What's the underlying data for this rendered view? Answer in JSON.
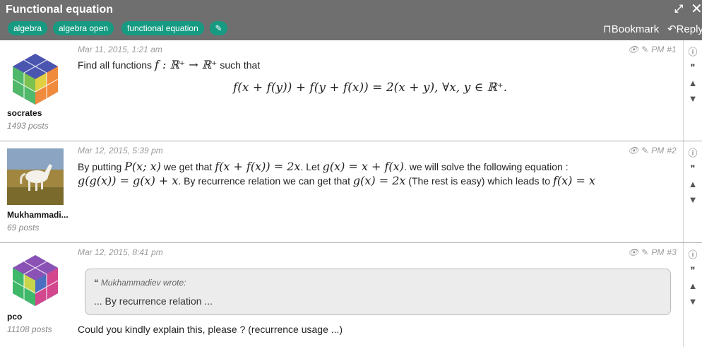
{
  "header": {
    "title": "Functional equation",
    "tags": [
      "algebra",
      "algebra open",
      "functional equation"
    ],
    "bookmark_label": "Bookmark",
    "reply_label": "Reply"
  },
  "posts": [
    {
      "date": "Mar 11, 2015, 1:21 am",
      "pm": "PM",
      "number": "#1",
      "user": "socrates",
      "post_count": "1493 posts",
      "text_a": "Find all functions",
      "math_a": "f : ℝ⁺ → ℝ⁺",
      "text_b": "such that",
      "display": "f(x + f(y)) + f(y + f(x)) = 2(x + y),    ∀x, y ∈ ℝ⁺."
    },
    {
      "date": "Mar 12, 2015, 5:39 pm",
      "pm": "PM",
      "number": "#2",
      "user": "Mukhammadi...",
      "post_count": "69 posts",
      "t1": "By putting",
      "m1": "P(x; x)",
      "t2": "we get that",
      "m2": "f(x + f(x)) = 2x",
      "t3": ". Let",
      "m3": "g(x) = x + f(x)",
      "t4": ". we will solve the following equation :",
      "m4": "g(g(x)) = g(x) + x",
      "t5": ". By recurrence relation we can get that",
      "m5": "g(x) = 2x",
      "t6": "(The rest is easy) which leads to",
      "m6": "f(x) = x"
    },
    {
      "date": "Mar 12, 2015, 8:41 pm",
      "pm": "PM",
      "number": "#3",
      "user": "pco",
      "post_count": "11108 posts",
      "quote_author": "Mukhammadiev wrote:",
      "quote_text": "... By recurrence relation ...",
      "text": "Could you kindly explain this, please ? (recurrence usage ...)"
    }
  ],
  "colors": {
    "header_bg": "#6f6f6f",
    "tag_bg": "#169b82",
    "meta_text": "#999999"
  },
  "icons": [
    "expand-icon",
    "close-icon",
    "pencil-icon",
    "bookmark-icon",
    "reply-icon",
    "eye-icon",
    "pm-icon",
    "report-icon",
    "quote-icon",
    "thumbs-up-icon",
    "thumbs-down-icon"
  ]
}
